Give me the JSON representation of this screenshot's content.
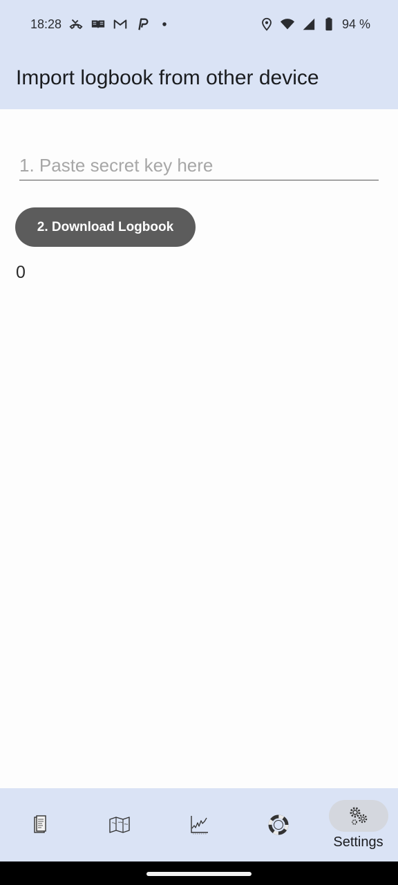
{
  "status_bar": {
    "time": "18:28",
    "left_icons": [
      "missed-call-icon",
      "book-icon",
      "gmail-icon",
      "paypal-icon",
      "dot-icon"
    ],
    "right_icons": [
      "location-icon",
      "wifi-icon",
      "signal-icon",
      "battery-icon"
    ],
    "battery": "94 %"
  },
  "app_bar": {
    "title": "Import logbook from other device"
  },
  "main": {
    "key_input": {
      "placeholder": "1. Paste secret key here",
      "value": ""
    },
    "download_button": "2. Download Logbook",
    "count": "0"
  },
  "bottom_nav": {
    "items": [
      {
        "icon": "logbook-icon",
        "label": ""
      },
      {
        "icon": "map-icon",
        "label": ""
      },
      {
        "icon": "chart-icon",
        "label": ""
      },
      {
        "icon": "lifebuoy-icon",
        "label": ""
      },
      {
        "icon": "settings-gears-icon",
        "label": "Settings",
        "active": true
      }
    ]
  },
  "colors": {
    "bar_background": "#dae3f5",
    "button_background": "#5c5c5c",
    "content_background": "#fdfdfd"
  }
}
